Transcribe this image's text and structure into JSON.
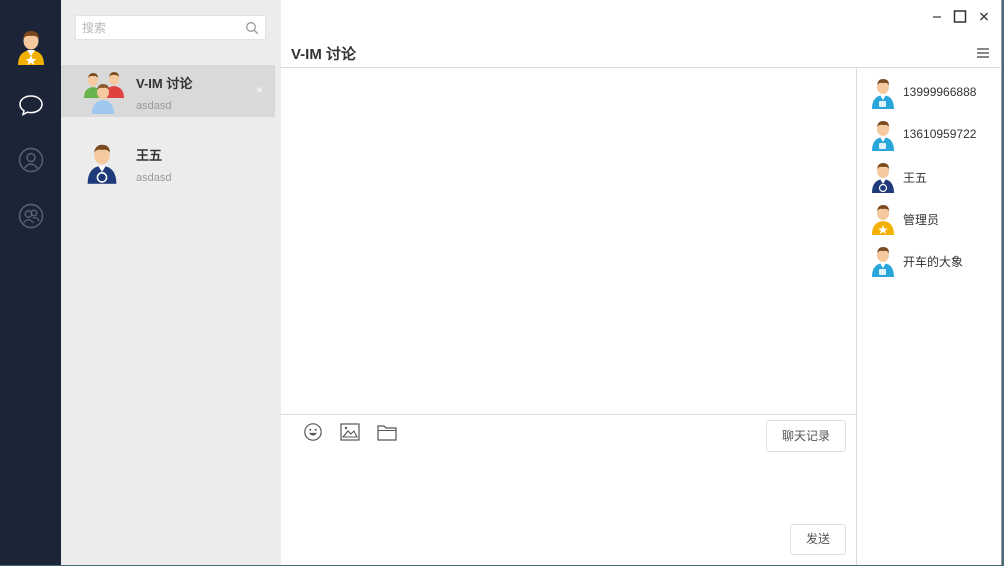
{
  "search": {
    "placeholder": "搜索"
  },
  "conversations": [
    {
      "name": "V-IM 讨论",
      "preview": "asdasd",
      "avatar": "group-avatar",
      "close": "×"
    },
    {
      "name": "王五",
      "preview": "asdasd",
      "avatar": "wordpress-avatar"
    }
  ],
  "chat": {
    "title": "V-IM 讨论",
    "history_label": "聊天记录",
    "send_label": "发送"
  },
  "members": [
    {
      "name": "13999966888",
      "avatar": "twitter-avatar"
    },
    {
      "name": "13610959722",
      "avatar": "twitter-avatar"
    },
    {
      "name": "王五",
      "avatar": "wordpress-avatar"
    },
    {
      "name": "管理员",
      "avatar": "star-avatar"
    },
    {
      "name": "开车的大象",
      "avatar": "twitter-avatar"
    }
  ],
  "colors": {
    "nav_bg": "#1c2438",
    "list_bg": "#ececec",
    "active_bg": "#d9d9d9",
    "divider": "#dcdcdc"
  }
}
